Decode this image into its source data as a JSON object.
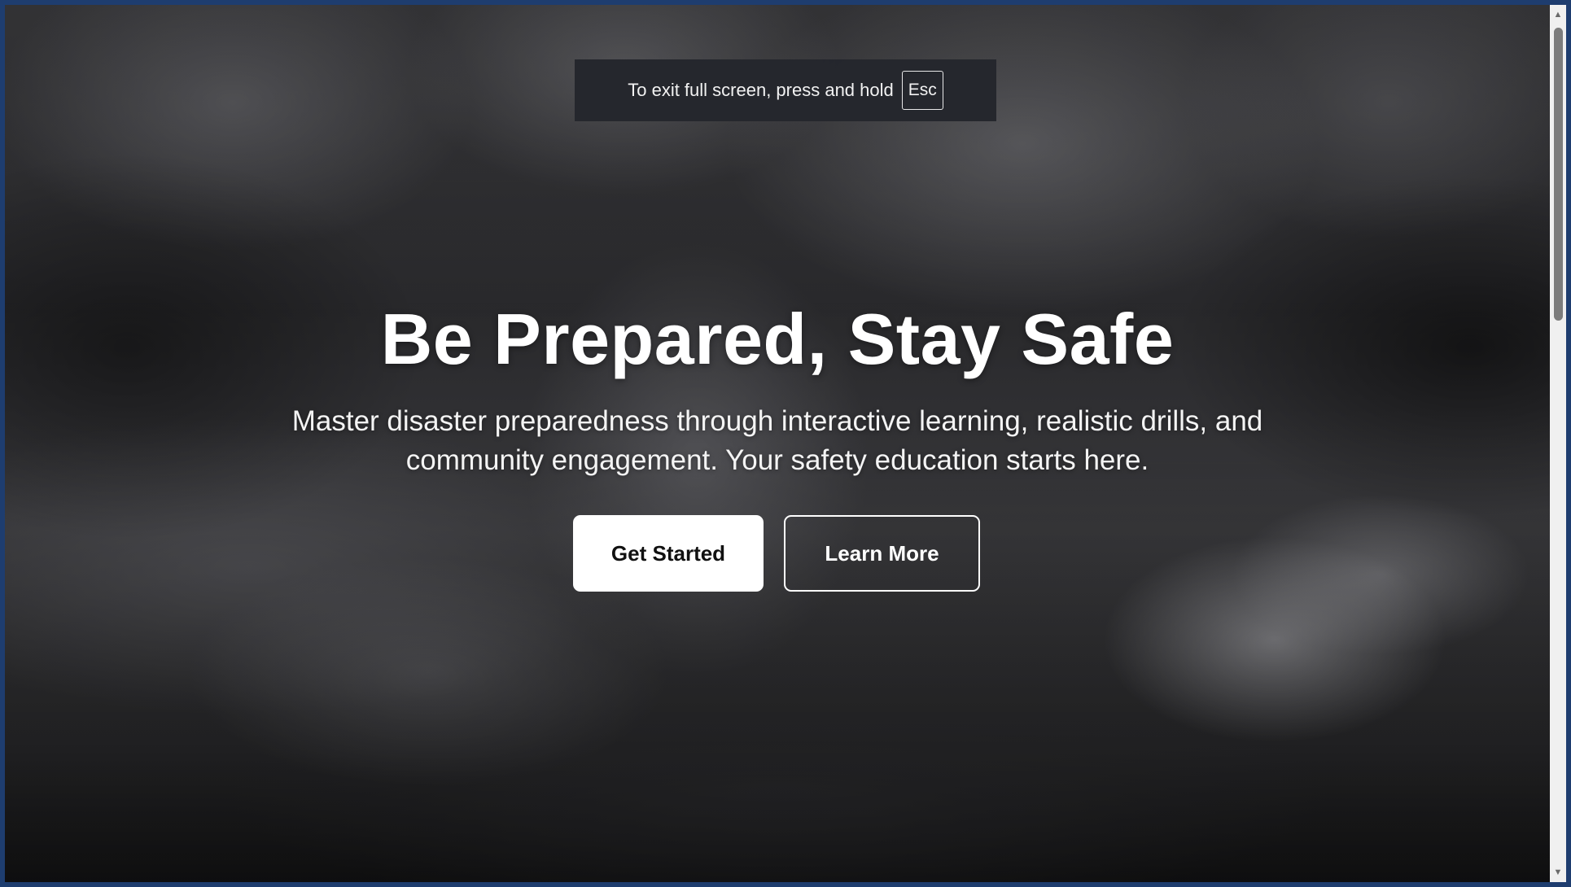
{
  "fullscreen_notice": {
    "text": "To exit full screen, press and hold",
    "key": "Esc"
  },
  "hero": {
    "title": "Be Prepared, Stay Safe",
    "subtitle": "Master disaster preparedness through interactive learning, realistic drills, and community engagement. Your safety education starts here.",
    "primary_button": "Get Started",
    "secondary_button": "Learn More"
  },
  "scrollbar": {
    "up_icon": "triangle-up",
    "down_icon": "triangle-down"
  },
  "colors": {
    "window_border": "#1e3d6f",
    "notice_bg": "#24262c",
    "primary_button_bg": "#ffffff",
    "primary_button_text": "#111111",
    "text": "#ffffff"
  }
}
